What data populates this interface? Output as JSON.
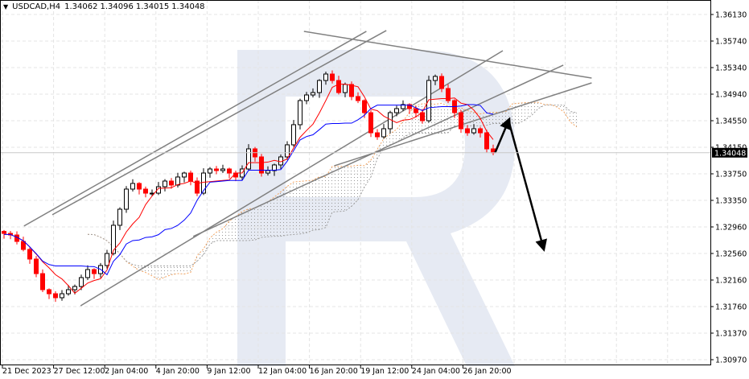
{
  "header": {
    "arrow": "▼",
    "symbol": "USDCAD,H4",
    "open": "1.34062",
    "high": "1.34096",
    "low": "1.34015",
    "close": "1.34048"
  },
  "chart_data": {
    "type": "candlestick",
    "title": "USDCAD,H4",
    "ylim": [
      1.3097,
      1.365
    ],
    "y_ticks": [
      "1.36130",
      "1.35740",
      "1.35340",
      "1.34940",
      "1.34550",
      "1.34150",
      "1.33750",
      "1.33350",
      "1.32960",
      "1.32560",
      "1.32160",
      "1.31760",
      "1.31370",
      "1.30970"
    ],
    "x_ticks": [
      "21 Dec 2023",
      "27 Dec 12:00",
      "2 Jan 04:00",
      "4 Jan 20:00",
      "9 Jan 12:00",
      "12 Jan 04:00",
      "16 Jan 20:00",
      "19 Jan 12:00",
      "24 Jan 04:00",
      "26 Jan 20:00"
    ],
    "current_price": "1.34048",
    "closes": [
      1.32833,
      1.32809,
      1.32712,
      1.32591,
      1.32446,
      1.32227,
      1.31985,
      1.31924,
      1.31864,
      1.31924,
      1.31985,
      1.32033,
      1.32167,
      1.32288,
      1.32227,
      1.32349,
      1.3253,
      1.32955,
      1.33197,
      1.335,
      1.33585,
      1.335,
      1.33439,
      1.33439,
      1.33536,
      1.33621,
      1.33561,
      1.33682,
      1.33742,
      1.33621,
      1.33439,
      1.33742,
      1.33803,
      1.33779,
      1.33803,
      1.33742,
      1.33682,
      1.33803,
      1.34106,
      1.33985,
      1.33742,
      1.33779,
      1.33864,
      1.33985,
      1.34167,
      1.3447,
      1.34833,
      1.34918,
      1.34954,
      1.35136,
      1.35233,
      1.35136,
      1.34954,
      1.35076,
      1.34894,
      1.34833,
      1.34651,
      1.34348,
      1.34288,
      1.34409,
      1.34651,
      1.34712,
      1.34773,
      1.34712,
      1.34651,
      1.3453,
      1.35136,
      1.35197,
      1.35015,
      1.34833,
      1.34651,
      1.34409,
      1.34348,
      1.34409,
      1.34348,
      1.34106,
      1.34048
    ],
    "indicators": [
      "Ichimoku Tenkan-sen",
      "Ichimoku Kijun-sen",
      "Ichimoku Cloud"
    ],
    "colors": {
      "bull": "#000000",
      "bear": "#ff0000",
      "tenkan": "#ff0000",
      "kijun": "#0000ff",
      "cloud_a": "#f4a460",
      "cloud_b": "#a0a0a0",
      "forecast_arrow": "#000000"
    },
    "trendlines": [
      {
        "from": [
          7.5,
          1.33114
        ],
        "to": [
          59.4,
          1.35888
        ]
      },
      {
        "from": [
          3.1,
          1.32944
        ],
        "to": [
          56.3,
          1.35876
        ]
      },
      {
        "from": [
          11.9,
          1.31743
        ],
        "to": [
          77.5,
          1.35585
        ]
      },
      {
        "from": [
          29.4,
          1.32787
        ],
        "to": [
          86.9,
          1.35367
        ]
      },
      {
        "from": [
          46.6,
          1.35876
        ],
        "to": [
          91.3,
          1.35173
        ]
      },
      {
        "from": [
          51.3,
          1.33851
        ],
        "to": [
          91.3,
          1.351
        ]
      }
    ],
    "forecast_arrows": [
      {
        "from": [
          76.3,
          1.34048
        ],
        "to": [
          78.4,
          1.3453
        ]
      },
      {
        "from": [
          78.4,
          1.3453
        ],
        "to": [
          83.8,
          1.32615
        ]
      }
    ]
  }
}
